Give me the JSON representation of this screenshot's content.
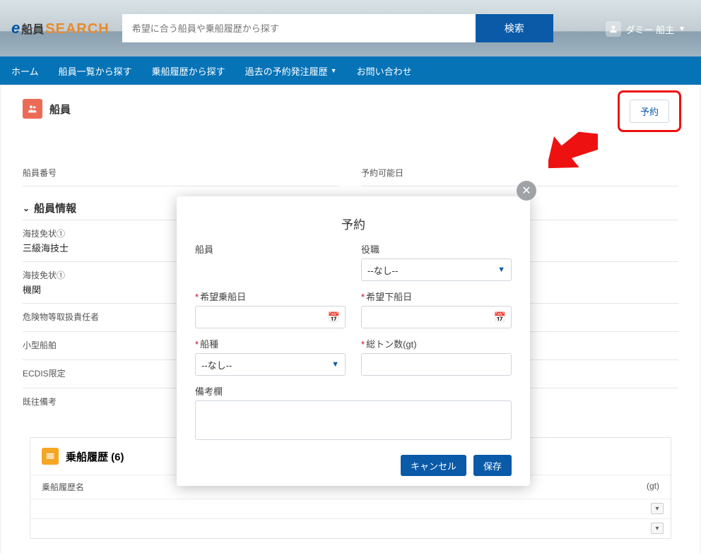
{
  "header": {
    "logo": {
      "e": "e",
      "cn": "船員",
      "search": "SEARCH"
    },
    "search_placeholder": "希望に合う船員や乗船履歴から探す",
    "search_button": "検索",
    "user_name": "ダミー 船主"
  },
  "nav": {
    "home": "ホーム",
    "crew_list": "船員一覧から探す",
    "history_search": "乗船履歴から探す",
    "past_orders": "過去の予約発注履歴",
    "contact": "お問い合わせ"
  },
  "page": {
    "title": "船員",
    "reserve_button": "予約",
    "field_crew_no": "船員番号",
    "field_available": "予約可能日",
    "section_crew_info": "船員情報",
    "rows": [
      {
        "label": "海技免状①",
        "value": "三級海技士"
      },
      {
        "label": "海技免状①",
        "value": "機関"
      },
      {
        "label": "危険物等取扱責任者",
        "value": ""
      },
      {
        "label": "小型船舶",
        "value": ""
      },
      {
        "label": "ECDIS限定",
        "value": ""
      },
      {
        "label": "既往備考",
        "value": ""
      }
    ],
    "history": {
      "title": "乗船履歴 (6)",
      "col1": "乗船履歴名",
      "col2": "(gt)"
    }
  },
  "modal": {
    "title": "予約",
    "crew_label": "船員",
    "role_label": "役職",
    "role_value": "--なし--",
    "board_label": "希望乗船日",
    "leave_label": "希望下船日",
    "shiptype_label": "船種",
    "shiptype_value": "--なし--",
    "gt_label": "総トン数(gt)",
    "remarks_label": "備考欄",
    "cancel": "キャンセル",
    "save": "保存"
  }
}
